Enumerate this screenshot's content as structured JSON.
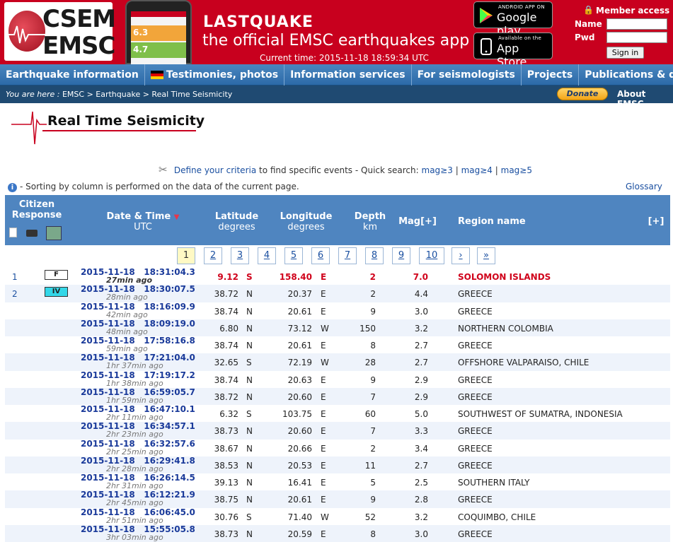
{
  "header": {
    "logo_top": "CSEM",
    "logo_bottom": "EMSC",
    "app_title": "LASTQUAKE",
    "app_subtitle": "the official EMSC earthquakes app",
    "current_time": "Current time: 2015-11-18 18:59:34 UTC",
    "phone_mag1": "6.3",
    "phone_mag2": "4.7",
    "gplay_small": "ANDROID APP ON",
    "gplay_big": "Google play",
    "appstore_small": "Available on the",
    "appstore_big": "App Store",
    "member_title": "Member access",
    "name_label": "Name",
    "pwd_label": "Pwd",
    "name_value": "",
    "pwd_value": "",
    "signin_label": "Sign in"
  },
  "nav": [
    "Earthquake information",
    "Testimonies, photos",
    "Information services",
    "For seismologists",
    "Projects",
    "Publications & docs"
  ],
  "crumb": {
    "you_are_here": "You are here :",
    "path": "EMSC > Earthquake > Real Time Seismicity",
    "donate": "Donate",
    "about": "About EMSC"
  },
  "page": {
    "title": "Real Time Seismicity",
    "criteria_link": "Define your criteria",
    "criteria_text": "to find specific events - Quick search:",
    "quick1": "mag≥3",
    "quick2": "mag≥4",
    "quick3": "mag≥5",
    "sep": "|",
    "info_text": "- Sorting by column is performed on the data of the current page.",
    "glossary": "Glossary"
  },
  "table_header": {
    "citizen": "Citizen",
    "response": "Response",
    "datetime": "Date & Time",
    "utc": "UTC",
    "latitude": "Latitude",
    "lat_unit": "degrees",
    "longitude": "Longitude",
    "lon_unit": "degrees",
    "depth": "Depth",
    "depth_unit": "km",
    "mag": "Mag[+]",
    "region": "Region name",
    "expand": "[+]"
  },
  "pager": [
    "1",
    "2",
    "3",
    "4",
    "5",
    "6",
    "7",
    "8",
    "9",
    "10",
    "›",
    "»"
  ],
  "rows": [
    {
      "idx": "1",
      "badge": "F",
      "date": "2015-11-18   18:31:04.3",
      "ago": "27min ago",
      "lat": "9.12",
      "ns": "S",
      "lon": "158.40",
      "ew": "E",
      "depth": "2",
      "mag": "7.0",
      "region": "SOLOMON ISLANDS"
    },
    {
      "idx": "2",
      "badge": "IV",
      "date": "2015-11-18   18:30:07.5",
      "ago": "28min ago",
      "lat": "38.72",
      "ns": "N",
      "lon": "20.37",
      "ew": "E",
      "depth": "2",
      "mag": "4.4",
      "region": "GREECE"
    },
    {
      "idx": "",
      "badge": "",
      "date": "2015-11-18   18:16:09.9",
      "ago": "42min ago",
      "lat": "38.74",
      "ns": "N",
      "lon": "20.61",
      "ew": "E",
      "depth": "9",
      "mag": "3.0",
      "region": "GREECE"
    },
    {
      "idx": "",
      "badge": "",
      "date": "2015-11-18   18:09:19.0",
      "ago": "48min ago",
      "lat": "6.80",
      "ns": "N",
      "lon": "73.12",
      "ew": "W",
      "depth": "150",
      "mag": "3.2",
      "region": "NORTHERN COLOMBIA"
    },
    {
      "idx": "",
      "badge": "",
      "date": "2015-11-18   17:58:16.8",
      "ago": "59min ago",
      "lat": "38.74",
      "ns": "N",
      "lon": "20.61",
      "ew": "E",
      "depth": "8",
      "mag": "2.7",
      "region": "GREECE"
    },
    {
      "idx": "",
      "badge": "",
      "date": "2015-11-18   17:21:04.0",
      "ago": "1hr 37min ago",
      "lat": "32.65",
      "ns": "S",
      "lon": "72.19",
      "ew": "W",
      "depth": "28",
      "mag": "2.7",
      "region": "OFFSHORE VALPARAISO, CHILE"
    },
    {
      "idx": "",
      "badge": "",
      "date": "2015-11-18   17:19:17.2",
      "ago": "1hr 38min ago",
      "lat": "38.74",
      "ns": "N",
      "lon": "20.63",
      "ew": "E",
      "depth": "9",
      "mag": "2.9",
      "region": "GREECE"
    },
    {
      "idx": "",
      "badge": "",
      "date": "2015-11-18   16:59:05.7",
      "ago": "1hr 59min ago",
      "lat": "38.72",
      "ns": "N",
      "lon": "20.60",
      "ew": "E",
      "depth": "7",
      "mag": "2.9",
      "region": "GREECE"
    },
    {
      "idx": "",
      "badge": "",
      "date": "2015-11-18   16:47:10.1",
      "ago": "2hr 11min ago",
      "lat": "6.32",
      "ns": "S",
      "lon": "103.75",
      "ew": "E",
      "depth": "60",
      "mag": "5.0",
      "region": "SOUTHWEST OF SUMATRA, INDONESIA"
    },
    {
      "idx": "",
      "badge": "",
      "date": "2015-11-18   16:34:57.1",
      "ago": "2hr 23min ago",
      "lat": "38.73",
      "ns": "N",
      "lon": "20.60",
      "ew": "E",
      "depth": "7",
      "mag": "3.3",
      "region": "GREECE"
    },
    {
      "idx": "",
      "badge": "",
      "date": "2015-11-18   16:32:57.6",
      "ago": "2hr 25min ago",
      "lat": "38.67",
      "ns": "N",
      "lon": "20.66",
      "ew": "E",
      "depth": "2",
      "mag": "3.4",
      "region": "GREECE"
    },
    {
      "idx": "",
      "badge": "",
      "date": "2015-11-18   16:29:41.8",
      "ago": "2hr 28min ago",
      "lat": "38.53",
      "ns": "N",
      "lon": "20.53",
      "ew": "E",
      "depth": "11",
      "mag": "2.7",
      "region": "GREECE"
    },
    {
      "idx": "",
      "badge": "",
      "date": "2015-11-18   16:26:14.5",
      "ago": "2hr 31min ago",
      "lat": "39.13",
      "ns": "N",
      "lon": "16.41",
      "ew": "E",
      "depth": "5",
      "mag": "2.5",
      "region": "SOUTHERN ITALY"
    },
    {
      "idx": "",
      "badge": "",
      "date": "2015-11-18   16:12:21.9",
      "ago": "2hr 45min ago",
      "lat": "38.75",
      "ns": "N",
      "lon": "20.61",
      "ew": "E",
      "depth": "9",
      "mag": "2.8",
      "region": "GREECE"
    },
    {
      "idx": "",
      "badge": "",
      "date": "2015-11-18   16:06:45.0",
      "ago": "2hr 51min ago",
      "lat": "30.76",
      "ns": "S",
      "lon": "71.40",
      "ew": "W",
      "depth": "52",
      "mag": "3.2",
      "region": "COQUIMBO, CHILE"
    },
    {
      "idx": "",
      "badge": "",
      "date": "2015-11-18   15:55:05.8",
      "ago": "3hr 03min ago",
      "lat": "38.73",
      "ns": "N",
      "lon": "20.59",
      "ew": "E",
      "depth": "8",
      "mag": "3.0",
      "region": "GREECE"
    }
  ],
  "colors": {
    "header_red": "#c8001e",
    "nav_blue": "#2c6aa8",
    "crumb_navy": "#1f4a72",
    "highlight_red": "#d0021b",
    "badge_iv": "#33d7e8"
  }
}
